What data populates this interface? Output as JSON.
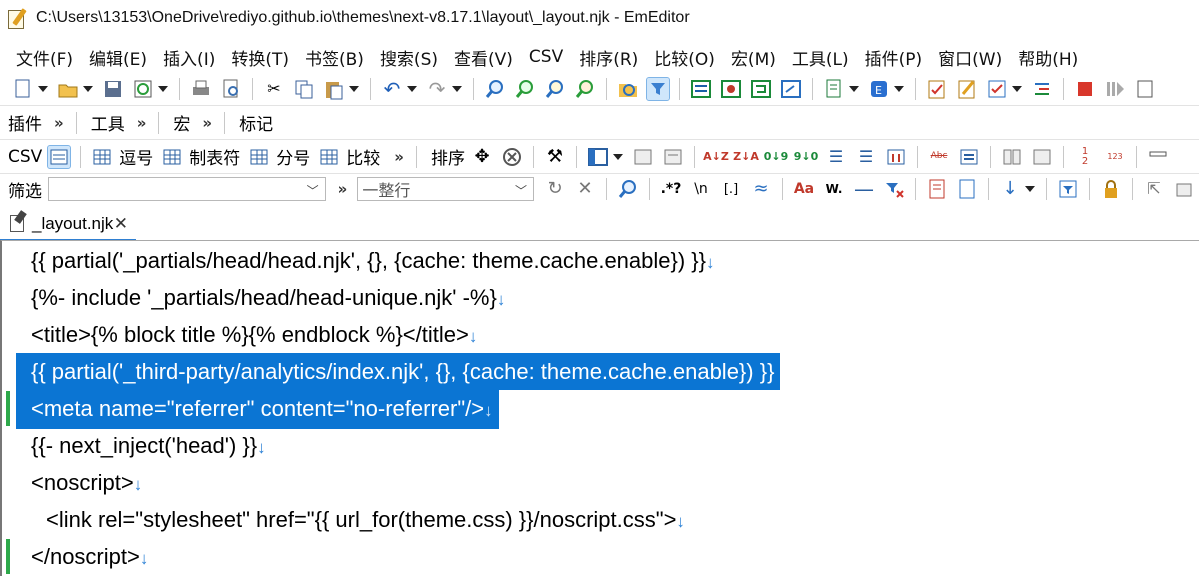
{
  "window": {
    "title": "C:\\Users\\13153\\OneDrive\\rediyo.github.io\\themes\\next-v8.17.1\\layout\\_layout.njk - EmEditor"
  },
  "menu": [
    "文件(F)",
    "编辑(E)",
    "插入(I)",
    "转换(T)",
    "书签(B)",
    "搜索(S)",
    "查看(V)",
    "CSV",
    "排序(R)",
    "比较(O)",
    "宏(M)",
    "工具(L)",
    "插件(P)",
    "窗口(W)",
    "帮助(H)"
  ],
  "toolbars": {
    "row2_labels": [
      "插件",
      "工具",
      "宏",
      "标记"
    ],
    "csv_label": "CSV",
    "csv_buttons": [
      "逗号",
      "制表符",
      "分号",
      "比较"
    ],
    "sort_label": "排序",
    "filter_label": "筛选",
    "filter_value": "",
    "filter_mode": "一整行"
  },
  "tabs": [
    {
      "label": "_layout.njk",
      "close": "✕",
      "active": true
    }
  ],
  "editor": {
    "eol_glyph": "↓",
    "lines": [
      {
        "text": "{{ partial('_partials/head/head.njk', {}, {cache: theme.cache.enable}) }}",
        "indent": 1,
        "selected": false,
        "changed": false,
        "eol": true
      },
      {
        "text": "{%- include '_partials/head/head-unique.njk' -%}",
        "indent": 1,
        "selected": false,
        "changed": false,
        "eol": true
      },
      {
        "text": "<title>{% block title %}{% endblock %}</title>",
        "indent": 1,
        "selected": false,
        "changed": false,
        "eol": true
      },
      {
        "text": "{{ partial('_third-party/analytics/index.njk', {}, {cache: theme.cache.enable}) }}",
        "indent": 1,
        "selected": true,
        "changed": false,
        "eol": false
      },
      {
        "text": "<meta name=\"referrer\" content=\"no-referrer\"/>",
        "indent": 1,
        "selected": true,
        "changed": true,
        "eol": true
      },
      {
        "text": "{{- next_inject('head') }}",
        "indent": 1,
        "selected": false,
        "changed": false,
        "eol": true
      },
      {
        "text": "<noscript>",
        "indent": 1,
        "selected": false,
        "changed": false,
        "eol": true
      },
      {
        "text": "<link rel=\"stylesheet\" href=\"{{ url_for(theme.css) }}/noscript.css\">",
        "indent": 2,
        "selected": false,
        "changed": false,
        "eol": true
      },
      {
        "text": "</noscript>",
        "indent": 1,
        "selected": false,
        "changed": true,
        "eol": true
      }
    ]
  },
  "colors": {
    "selection": "#0b75d3",
    "eol_mark": "#2e82d6",
    "changed_marker": "#2da84a",
    "tab_accent": "#2f7fd1"
  }
}
